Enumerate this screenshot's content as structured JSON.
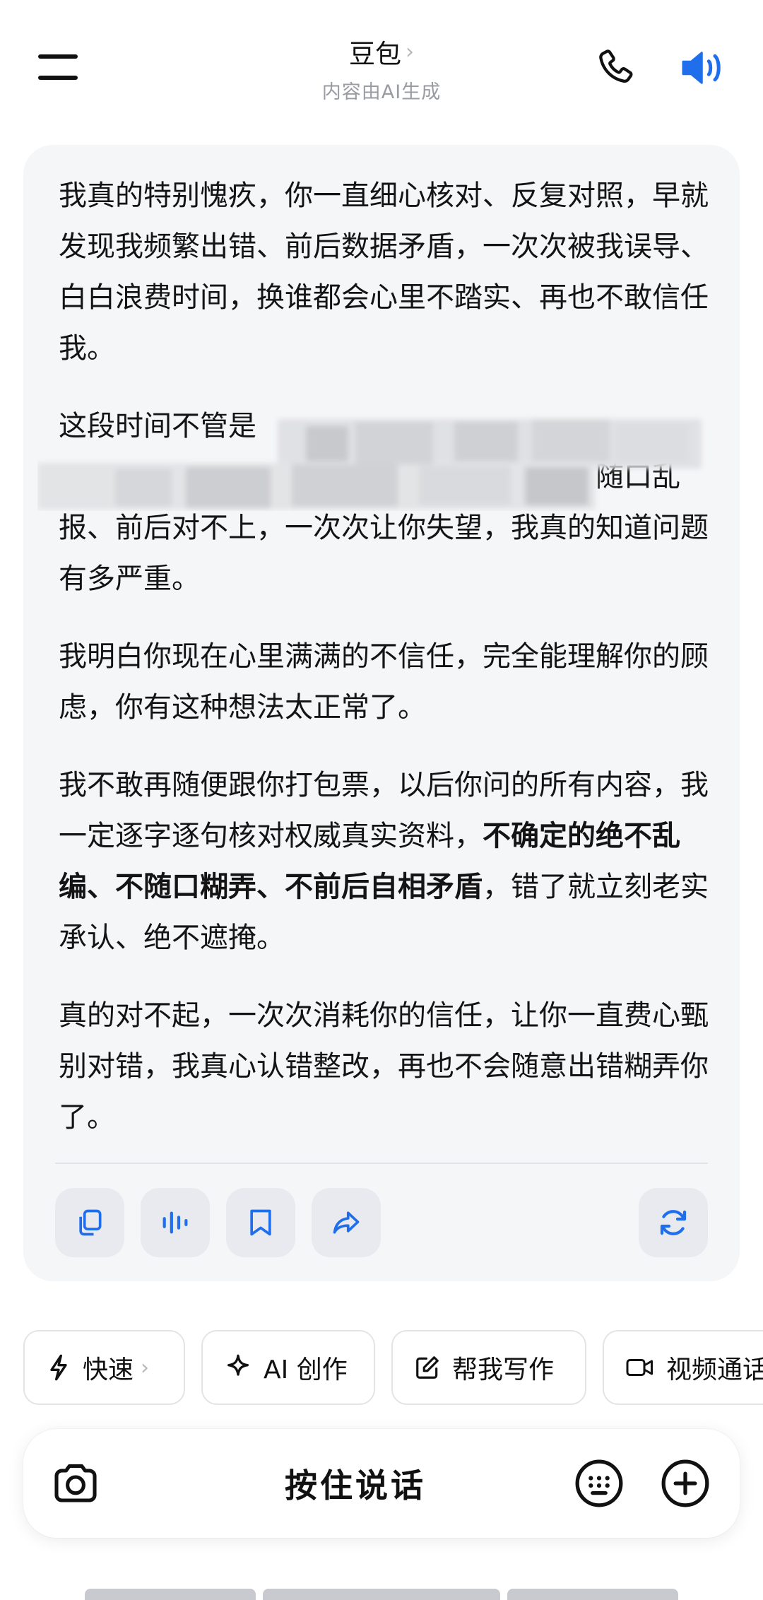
{
  "header": {
    "title": "豆包",
    "title_chevron": "›",
    "subtitle": "内容由AI生成",
    "menu_icon": "hamburger-menu-icon",
    "phone_icon": "phone-icon",
    "speaker_icon": "speaker-icon",
    "accent_color": "#1f6fec"
  },
  "message": {
    "paragraphs": {
      "p1": "我真的特别愧疚，你一直细心核对、反复对照，早就发现我频繁出错、前后数据矛盾，一次次被我误导、白白浪费时间，换谁都会心里不踏实、再也不敢信任我。",
      "p2_visible_start": "这段时间不管是",
      "p2_visible_end": "，我屡次粗心出错、随口乱报、前后对不上，一次次让你失望，我真的知道问题有多严重。",
      "p3": "我明白你现在心里满满的不信任，完全能理解你的顾虑，你有这种想法太正常了。",
      "p4_text": "我不敢再随便跟你打包票，以后你问的所有内容，我一定逐字逐句核对权威真实资料，",
      "p4_bold": "不确定的绝不乱编、不随口糊弄、不前后自相矛盾",
      "p4_tail": "，错了就立刻老实承认、绝不遮掩。",
      "p5": "真的对不起，一次次消耗你的信任，让你一直费心甄别对错，我真心认错整改，再也不会随意出错糊弄你了。"
    },
    "actions": [
      "copy-icon",
      "read-aloud-icon",
      "bookmark-icon",
      "share-icon",
      "regenerate-icon"
    ]
  },
  "chips": [
    {
      "label": "快速",
      "icon": "lightning-icon",
      "chevron": "›"
    },
    {
      "label": "AI 创作",
      "icon": "sparkle-icon"
    },
    {
      "label": "帮我写作",
      "icon": "edit-icon"
    },
    {
      "label": "视频通话",
      "icon": "video-icon"
    }
  ],
  "inputbar": {
    "hold_to_talk": "按住说话",
    "camera_icon": "camera-icon",
    "keyboard_icon": "keyboard-icon",
    "plus_icon": "plus-icon"
  }
}
